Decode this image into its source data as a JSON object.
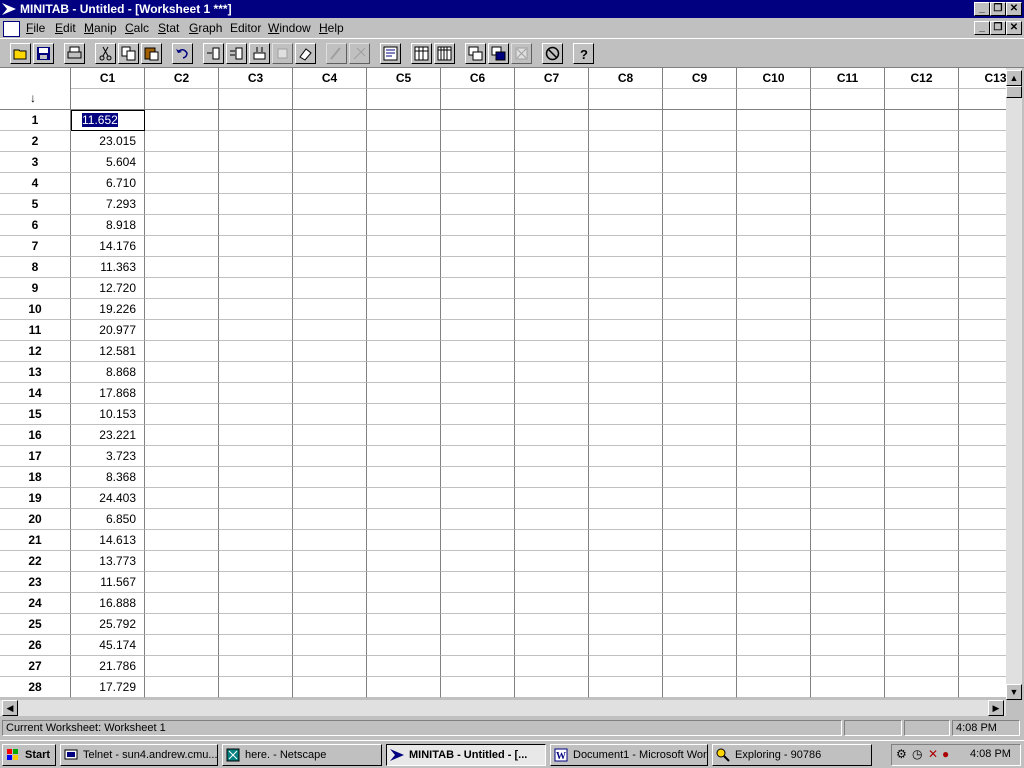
{
  "window": {
    "title": "MINITAB - Untitled - [Worksheet 1 ***]"
  },
  "menu": [
    {
      "key": "F",
      "rest": "ile"
    },
    {
      "key": "E",
      "rest": "dit"
    },
    {
      "key": "M",
      "rest": "anip"
    },
    {
      "key": "C",
      "rest": "alc"
    },
    {
      "key": "S",
      "rest": "tat"
    },
    {
      "key": "G",
      "rest": "raph"
    },
    {
      "key": "",
      "rest": "Editor"
    },
    {
      "key": "W",
      "rest": "indow"
    },
    {
      "key": "H",
      "rest": "elp"
    }
  ],
  "toolbar": [
    "open-icon",
    "save-icon",
    "print-icon",
    "cut-icon",
    "copy-icon",
    "paste-icon",
    "undo-icon",
    "insert-cells-icon",
    "insert-rows-icon",
    "insert-columns-icon",
    "delete-cells-icon",
    "erase-icon",
    "brush-icon",
    "link-icon",
    "session-window-icon",
    "data-window-icon",
    "info-window-icon",
    "tile-icon",
    "cascade-icon",
    "close-graphs-icon",
    "cancel-icon",
    "help-icon"
  ],
  "worksheet": {
    "columns": [
      "C1",
      "C2",
      "C3",
      "C4",
      "C5",
      "C6",
      "C7",
      "C8",
      "C9",
      "C10",
      "C11",
      "C12",
      "C13"
    ],
    "entry_arrow": "↓",
    "rows": [
      "1",
      "2",
      "3",
      "4",
      "5",
      "6",
      "7",
      "8",
      "9",
      "10",
      "11",
      "12",
      "13",
      "14",
      "15",
      "16",
      "17",
      "18",
      "19",
      "20",
      "21",
      "22",
      "23",
      "24",
      "25",
      "26",
      "27",
      "28"
    ],
    "c1_values": [
      "11.652",
      "23.015",
      "5.604",
      "6.710",
      "7.293",
      "8.918",
      "14.176",
      "11.363",
      "12.720",
      "19.226",
      "20.977",
      "12.581",
      "8.868",
      "17.868",
      "10.153",
      "23.221",
      "3.723",
      "8.368",
      "24.403",
      "6.850",
      "14.613",
      "13.773",
      "11.567",
      "16.888",
      "25.792",
      "45.174",
      "21.786",
      "17.729"
    ]
  },
  "status": {
    "text": "Current Worksheet: Worksheet 1",
    "time": "4:08 PM"
  },
  "taskbar": {
    "start": "Start",
    "tasks": [
      {
        "label": "Telnet - sun4.andrew.cmu....",
        "active": false
      },
      {
        "label": "here. - Netscape",
        "active": false
      },
      {
        "label": "MINITAB - Untitled - [...",
        "active": true
      },
      {
        "label": "Document1 - Microsoft Word",
        "active": false
      },
      {
        "label": "Exploring - 90786",
        "active": false
      }
    ],
    "clock": "4:08 PM"
  },
  "colors": {
    "titlebar": "#000080",
    "selection": "#000080",
    "face": "#c0c0c0"
  }
}
